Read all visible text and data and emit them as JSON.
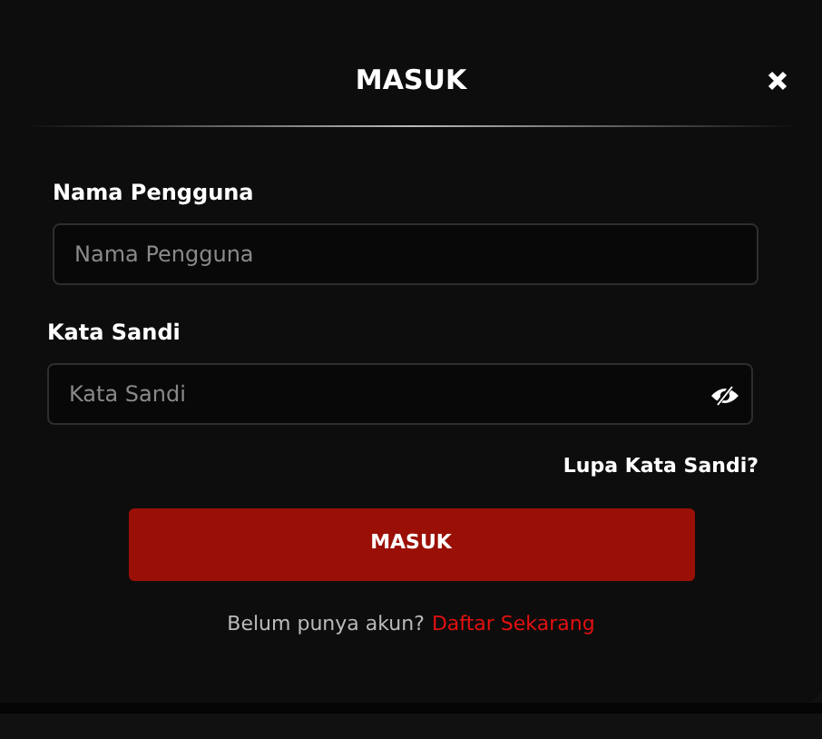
{
  "dialog": {
    "title": "MASUK",
    "fields": [
      {
        "label": "Nama Pengguna",
        "placeholder": "Nama Pengguna",
        "kind": "text"
      },
      {
        "label": "Kata Sandi",
        "placeholder": "Kata Sandi",
        "kind": "password"
      }
    ],
    "forgot_link": "Lupa Kata Sandi?",
    "submit_button": "MASUK",
    "register_prompt": "Belum punya akun?",
    "register_link": "Daftar Sekarang"
  }
}
